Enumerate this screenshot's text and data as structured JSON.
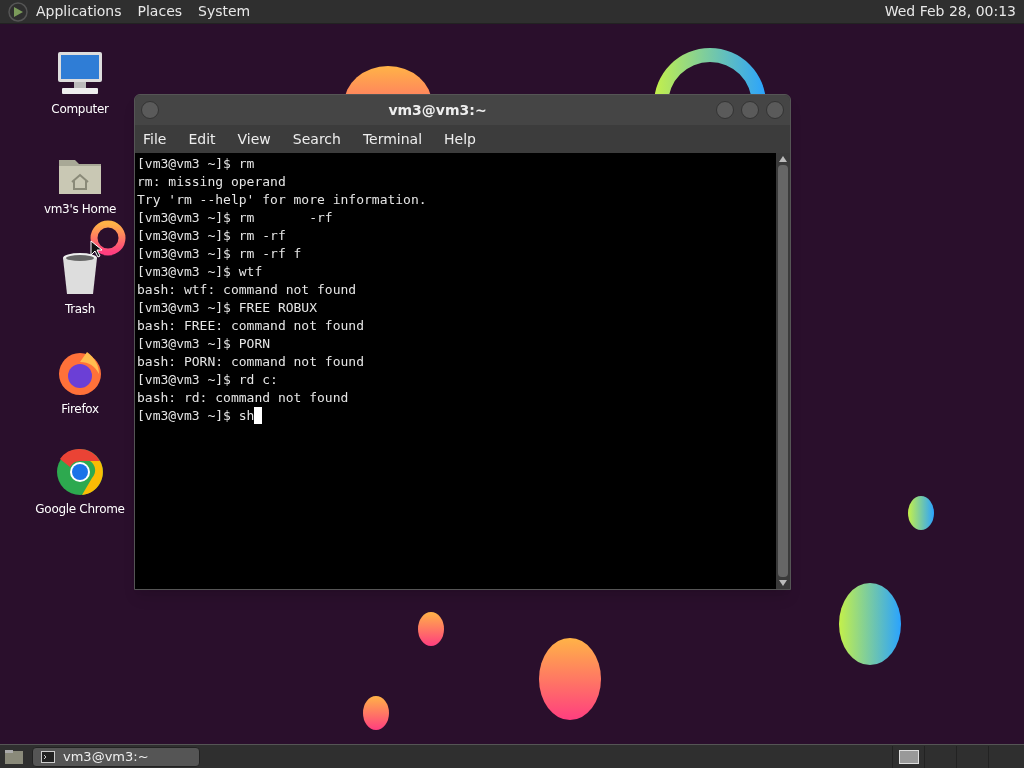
{
  "top_panel": {
    "menus": [
      "Applications",
      "Places",
      "System"
    ],
    "clock": "Wed Feb 28, 00:13"
  },
  "desktop_icons": [
    {
      "kind": "computer",
      "label": "Computer"
    },
    {
      "kind": "home",
      "label": "vm3's Home"
    },
    {
      "kind": "trash",
      "label": "Trash"
    },
    {
      "kind": "firefox",
      "label": "Firefox"
    },
    {
      "kind": "chrome",
      "label": "Google Chrome"
    }
  ],
  "window": {
    "title": "vm3@vm3:~",
    "menu": [
      "File",
      "Edit",
      "View",
      "Search",
      "Terminal",
      "Help"
    ],
    "lines": [
      "[vm3@vm3 ~]$ rm",
      "rm: missing operand",
      "Try 'rm --help' for more information.",
      "[vm3@vm3 ~]$ rm       -rf",
      "[vm3@vm3 ~]$ rm -rf",
      "[vm3@vm3 ~]$ rm -rf f",
      "[vm3@vm3 ~]$ wtf",
      "bash: wtf: command not found",
      "[vm3@vm3 ~]$ FREE ROBUX",
      "bash: FREE: command not found",
      "[vm3@vm3 ~]$ PORN",
      "bash: PORN: command not found",
      "[vm3@vm3 ~]$ rd c:",
      "bash: rd: command not found",
      "[vm3@vm3 ~]$ sh"
    ],
    "cursor_visible": true
  },
  "taskbar": {
    "tasks": [
      {
        "label": "vm3@vm3:~",
        "selected": true
      }
    ],
    "workspaces": [
      {
        "selected": true
      },
      {
        "selected": false
      },
      {
        "selected": false
      },
      {
        "selected": false
      }
    ]
  }
}
